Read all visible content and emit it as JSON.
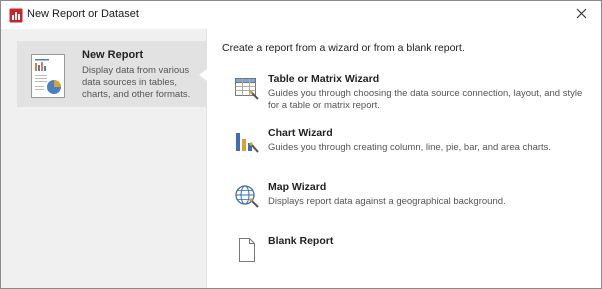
{
  "window": {
    "title": "New Report or Dataset",
    "close_glyph": "✕"
  },
  "sidebar": {
    "items": [
      {
        "title": "New Report",
        "description": "Display data from various data sources in tables, charts, and other formats.",
        "icon": "report-thumbnail-icon",
        "selected": true
      }
    ]
  },
  "main": {
    "heading": "Create a report from a wizard or from a blank report.",
    "options": [
      {
        "title": "Table or Matrix Wizard",
        "description": "Guides you through choosing the data source connection, layout, and style for a table or matrix report.",
        "icon": "table-wizard-icon"
      },
      {
        "title": "Chart Wizard",
        "description": "Guides you through creating column, line, pie, bar, and area charts.",
        "icon": "chart-wizard-icon"
      },
      {
        "title": "Map Wizard",
        "description": "Displays report data against a geographical background.",
        "icon": "map-wizard-icon"
      },
      {
        "title": "Blank Report",
        "description": "",
        "icon": "blank-report-icon"
      }
    ]
  },
  "colors": {
    "brand_red": "#c8262c",
    "selected_bg": "#e2e2e2",
    "sidebar_bg": "#f0f0f0"
  }
}
